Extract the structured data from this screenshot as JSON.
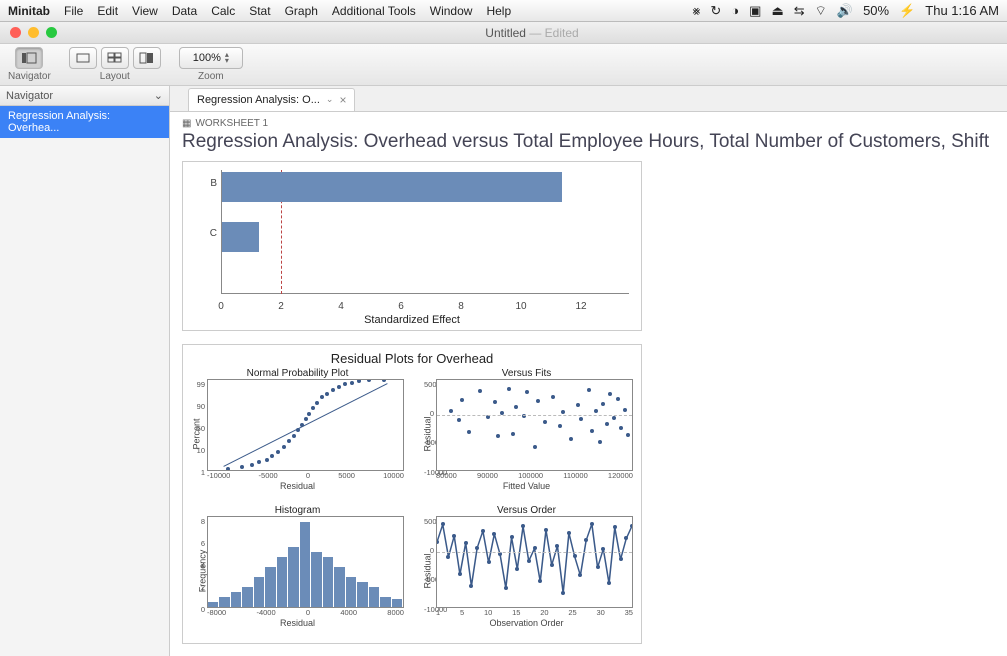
{
  "menubar": {
    "app": "Minitab",
    "items": [
      "File",
      "Edit",
      "View",
      "Data",
      "Calc",
      "Stat",
      "Graph",
      "Additional Tools",
      "Window",
      "Help"
    ],
    "status": {
      "battery_pct": "50%",
      "clock": "Thu 1:16 AM"
    }
  },
  "window": {
    "title": "Untitled",
    "title_suffix": "Edited"
  },
  "toolbar": {
    "nav_label": "Navigator",
    "layout_label": "Layout",
    "zoom_label": "Zoom",
    "zoom_value": "100%"
  },
  "sidebar": {
    "header": "Navigator",
    "items": [
      "Regression Analysis: Overhea..."
    ]
  },
  "tab": {
    "label": "Regression Analysis: O..."
  },
  "doc": {
    "worksheet": "WORKSHEET 1",
    "headline": "Regression Analysis: Overhead versus Total Employee Hours, Total Number of Customers, Shift"
  },
  "chart_data": [
    {
      "type": "bar",
      "orientation": "horizontal",
      "title": "",
      "xlabel": "Standardized Effect",
      "categories": [
        "B",
        "C"
      ],
      "values": [
        11,
        1.2
      ],
      "reference_line": 2,
      "x_ticks": [
        0,
        2,
        4,
        6,
        8,
        10,
        12
      ],
      "xlim": [
        0,
        13
      ]
    },
    {
      "type": "composite",
      "title": "Residual Plots for Overhead",
      "subplots": [
        {
          "name": "Normal Probability Plot",
          "type": "scatter",
          "xlabel": "Residual",
          "ylabel": "Percent",
          "x_ticks": [
            -10000,
            -5000,
            0,
            5000,
            10000
          ],
          "y_ticks": [
            1,
            10,
            50,
            90,
            99
          ],
          "fit_line": true,
          "series": [
            {
              "name": "residual_npp",
              "x": [
                -8000,
                -6500,
                -5500,
                -4800,
                -4000,
                -3400,
                -2800,
                -2200,
                -1700,
                -1200,
                -800,
                -400,
                0,
                400,
                800,
                1200,
                1700,
                2200,
                2800,
                3400,
                4000,
                4800,
                5500,
                6500,
                8000
              ],
              "y": [
                2,
                4,
                6,
                9,
                12,
                16,
                20,
                26,
                32,
                38,
                44,
                50,
                56,
                62,
                68,
                74,
                80,
                84,
                88,
                91,
                94,
                96,
                97.5,
                98.5,
                99
              ]
            }
          ]
        },
        {
          "name": "Versus Fits",
          "type": "scatter",
          "xlabel": "Fitted Value",
          "ylabel": "Residual",
          "x_ticks": [
            80000,
            90000,
            100000,
            110000,
            120000
          ],
          "y_ticks": [
            -10000,
            -5000,
            0,
            5000
          ],
          "series": [
            {
              "name": "resid_vs_fit",
              "x": [
                82000,
                84000,
                85000,
                87000,
                90000,
                92000,
                94000,
                95000,
                96000,
                98000,
                99000,
                100000,
                102000,
                103000,
                105000,
                106000,
                108000,
                110000,
                112000,
                113000,
                115000,
                117000,
                118000,
                120000,
                121000,
                122000,
                123000,
                124000,
                125000,
                126000,
                127000,
                128000,
                129000,
                130000,
                131000
              ],
              "y": [
                800,
                -1000,
                3000,
                -3500,
                4800,
                -500,
                2500,
                -4200,
                300,
                5200,
                -3800,
                1600,
                -200,
                4500,
                -6500,
                2800,
                -1400,
                3500,
                -2300,
                600,
                -4800,
                1900,
                -900,
                5000,
                -3200,
                700,
                -5500,
                2100,
                -1800,
                4200,
                -600,
                3100,
                -2600,
                900,
                -4100
              ]
            }
          ]
        },
        {
          "name": "Histogram",
          "type": "bar",
          "xlabel": "Residual",
          "ylabel": "Frequency",
          "x_ticks": [
            -8000,
            -4000,
            0,
            4000,
            8000
          ],
          "y_ticks": [
            0,
            2,
            4,
            6,
            8
          ],
          "categories": [
            -8000,
            -7000,
            -6000,
            -5000,
            -4000,
            -3000,
            -2000,
            -1000,
            0,
            1000,
            2000,
            3000,
            4000,
            5000,
            6000,
            7000,
            8000
          ],
          "values": [
            0.5,
            1,
            1.5,
            2,
            3,
            4,
            5,
            6,
            8.5,
            5.5,
            5,
            4,
            3,
            2.5,
            2,
            1,
            0.8
          ]
        },
        {
          "name": "Versus Order",
          "type": "line",
          "xlabel": "Observation Order",
          "ylabel": "Residual",
          "x_ticks": [
            1,
            5,
            10,
            15,
            20,
            25,
            30,
            35
          ],
          "y_ticks": [
            -10000,
            -5000,
            0,
            5000
          ],
          "series": [
            {
              "name": "resid_vs_order",
              "x": [
                1,
                2,
                3,
                4,
                5,
                6,
                7,
                8,
                9,
                10,
                11,
                12,
                13,
                14,
                15,
                16,
                17,
                18,
                19,
                20,
                21,
                22,
                23,
                24,
                25,
                26,
                27,
                28,
                29,
                30,
                31,
                32,
                33,
                34,
                35
              ],
              "y": [
                2000,
                5500,
                -1000,
                3200,
                -4500,
                1800,
                -6800,
                800,
                4200,
                -2100,
                3600,
                -500,
                -7200,
                2900,
                -3400,
                5100,
                -1800,
                700,
                -5900,
                4400,
                -2600,
                1200,
                -8200,
                3800,
                -900,
                -4700,
                2300,
                5600,
                -3100,
                600,
                -6300,
                4900,
                -1500,
                2700,
                5200
              ]
            }
          ]
        }
      ]
    }
  ]
}
